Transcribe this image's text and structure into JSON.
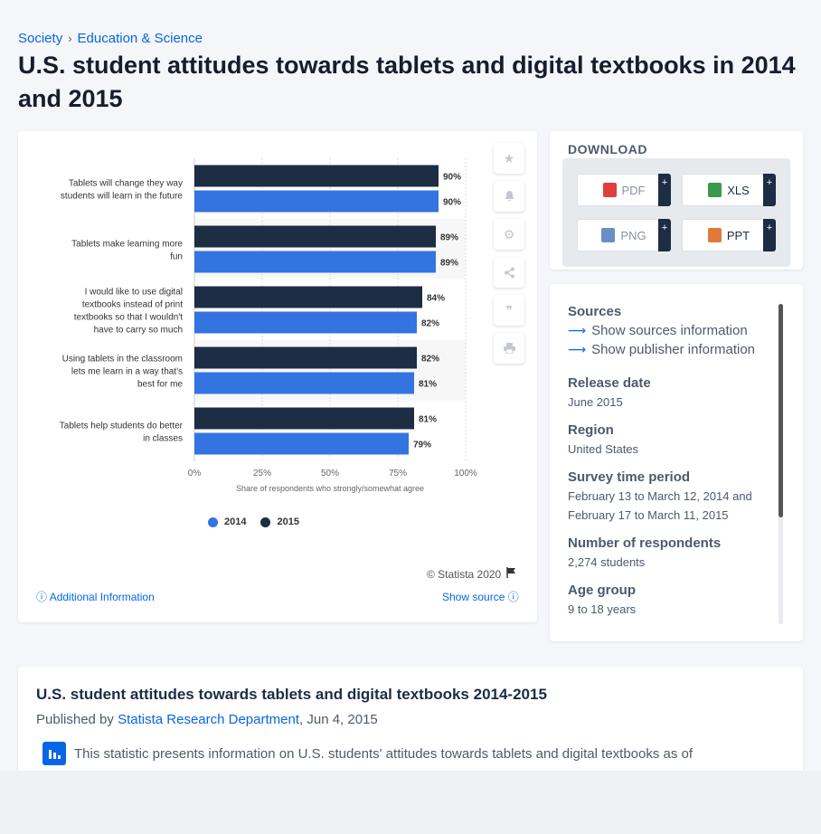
{
  "breadcrumb": {
    "item1": "Society",
    "item2": "Education & Science"
  },
  "title": "U.S. student attitudes towards tablets and digital textbooks in 2014 and 2015",
  "chart_data": {
    "type": "bar",
    "orientation": "horizontal",
    "categories": [
      [
        "Tablets will change they way",
        "students will learn in the future"
      ],
      [
        "Tablets make learning more",
        "fun"
      ],
      [
        "I would like to use digital",
        "textbooks instead of print",
        "textbooks so that I wouldn't",
        "have to carry so much"
      ],
      [
        "Using tablets in the classroom",
        "lets me learn in a way that's",
        "best for me"
      ],
      [
        "Tablets help students do better",
        "in classes"
      ]
    ],
    "series": [
      {
        "name": "2015",
        "color": "#1c2d44",
        "values": [
          90,
          89,
          84,
          82,
          81
        ],
        "labels": [
          "90%",
          "89%",
          "84%",
          "82%",
          "81%"
        ]
      },
      {
        "name": "2014",
        "color": "#3474e0",
        "values": [
          90,
          89,
          82,
          81,
          79
        ],
        "labels": [
          "90%",
          "89%",
          "82%",
          "81%",
          "79%"
        ]
      }
    ],
    "xticks": [
      "0%",
      "25%",
      "50%",
      "75%",
      "100%"
    ],
    "xlim": [
      0,
      100
    ],
    "xlabel": "Share of respondents who strongly/somewhat agree",
    "legend": [
      {
        "name": "2014",
        "color": "#3474e0"
      },
      {
        "name": "2015",
        "color": "#1c2d44"
      }
    ],
    "grid": true,
    "legend_position": "bottom"
  },
  "chart_footer": {
    "copyright": "© Statista 2020",
    "additional_info": "Additional Information",
    "show_source": "Show source"
  },
  "download": {
    "title": "DOWNLOAD",
    "buttons": [
      {
        "label": "PDF",
        "color": "#e0403a"
      },
      {
        "label": "XLS",
        "color": "#3a9a4a"
      },
      {
        "label": "PNG",
        "color": "#6a8fc8"
      },
      {
        "label": "PPT",
        "color": "#e07a3a"
      }
    ],
    "plus": "+"
  },
  "info": {
    "sources_heading": "Sources",
    "show_sources": "Show sources information",
    "show_publisher": "Show publisher information",
    "release_heading": "Release date",
    "release_value": "June 2015",
    "region_heading": "Region",
    "region_value": "United States",
    "survey_heading": "Survey time period",
    "survey_value": "February 13 to March 12, 2014 and February 17 to March 11, 2015",
    "respondents_heading": "Number of respondents",
    "respondents_value": "2,274 students",
    "age_heading": "Age group",
    "age_value": "9 to 18 years"
  },
  "description": {
    "title": "U.S. student attitudes towards tablets and digital textbooks 2014-2015",
    "published_by": "Published by",
    "publisher": "Statista Research Department",
    "date": ", Jun 4, 2015",
    "text": "This statistic presents information on U.S. students' attitudes towards tablets and digital textbooks as of"
  }
}
